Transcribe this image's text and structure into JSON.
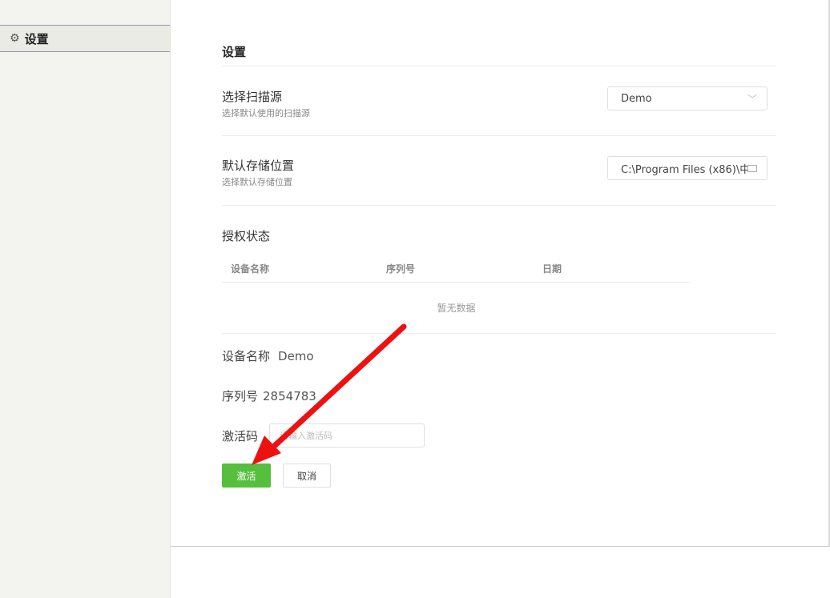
{
  "sidebar": {
    "items": [
      {
        "icon": "gear-icon",
        "label": "设置"
      }
    ]
  },
  "settings": {
    "title": "设置",
    "scan_source": {
      "title": "选择扫描源",
      "desc": "选择默认使用的扫描源",
      "value": "Demo"
    },
    "storage": {
      "title": "默认存储位置",
      "desc": "选择默认存储位置",
      "value": "C:\\Program Files (x86)\\中"
    },
    "auth": {
      "title": "授权状态",
      "columns": [
        "设备名称",
        "序列号",
        "日期"
      ],
      "empty_text": "暂无数据"
    },
    "device": {
      "label": "设备名称",
      "value": "Demo"
    },
    "serial": {
      "label": "序列号",
      "value": "2854783"
    },
    "activation": {
      "label": "激活码",
      "placeholder": "请输入激活码",
      "value": ""
    },
    "buttons": {
      "activate": "激活",
      "cancel": "取消"
    }
  },
  "colors": {
    "primary": "#57bf3e",
    "annotation_arrow": "#ee1111"
  }
}
